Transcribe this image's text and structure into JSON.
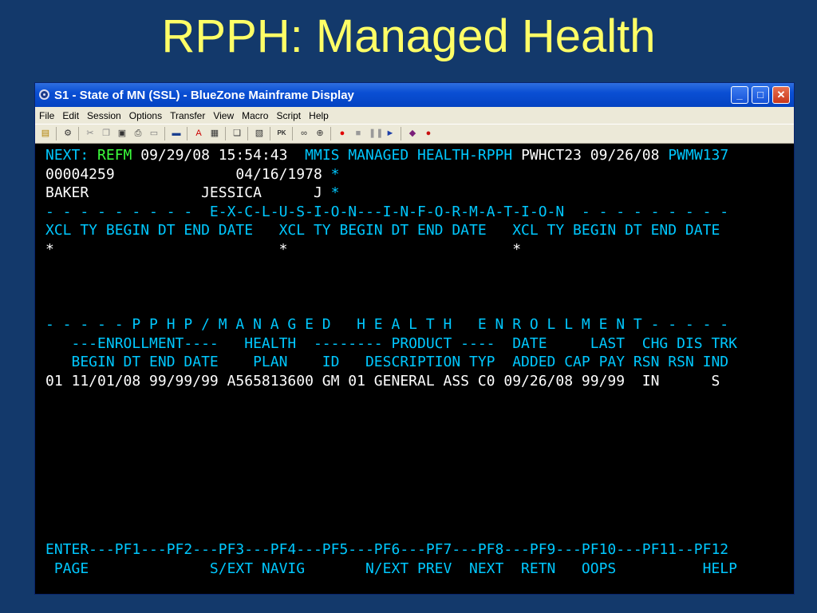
{
  "slide": {
    "title": "RPPH: Managed Health"
  },
  "window": {
    "title": "S1 - State of MN (SSL) - BlueZone Mainframe Display",
    "menu": [
      "File",
      "Edit",
      "Session",
      "Options",
      "Transfer",
      "View",
      "Macro",
      "Script",
      "Help"
    ]
  },
  "toolbar_icons": [
    "new-session-icon",
    "session-properties-icon",
    "cut-icon",
    "copy-icon",
    "save-icon",
    "print-icon",
    "print-preview-icon",
    "display-icon",
    "font-icon",
    "keyboard-map-icon",
    "clipboard-icon",
    "script-icon",
    "pk-icon",
    "glasses-icon",
    "zoom-icon",
    "record-icon",
    "stop-icon",
    "pause-icon",
    "play-icon",
    "book-icon",
    "apple-icon"
  ],
  "colors": {
    "cyan": "#00c8ff",
    "white": "#ffffff",
    "green": "#3cff3c",
    "title_yellow": "#ffff66",
    "background": "#13396b"
  },
  "terminal": {
    "r1": {
      "next_label": "NEXT: ",
      "next_value": "REFM",
      "timestamp": " 09/29/08 15:54:43  ",
      "system": "MMIS MANAGED HEALTH-RPPH ",
      "user": "PWHCT23 09/26/08 ",
      "terminal_id": "PWMW137"
    },
    "r2": {
      "id": "00004259              04/16/1978 ",
      "star": "*"
    },
    "r3": {
      "name": "BAKER             JESSICA      J ",
      "star": "*"
    },
    "r4": "- - - - - - - - -  E-X-C-L-U-S-I-O-N---I-N-F-O-R-M-A-T-I-O-N  - - - - - - - - -",
    "r5": "XCL TY BEGIN DT END DATE   XCL TY BEGIN DT END DATE   XCL TY BEGIN DT END DATE",
    "r6": "*                          *                          *",
    "r7": "- - - - - P P H P / M A N A G E D   H E A L T H   E N R O L L M E N T - - - - -",
    "r8": {
      "a": "   ---ENROLLMENT----   HEALTH  -------- PRODUCT ----  ",
      "b": "DATE     LAST  CHG DIS TRK"
    },
    "r9": {
      "a": "   BEGIN DT END DATE    PLAN    ID   DESCRIPTION TYP  ",
      "b": "ADDED CAP PAY RSN RSN IND"
    },
    "r10": "01 11/01/08 99/99/99 A565813600 GM 01 GENERAL ASS C0 09/26/08 99/99  IN      S",
    "r11": "ENTER---PF1---PF2---PF3---PF4---PF5---PF6---PF7---PF8---PF9---PF10---PF11--PF12",
    "r12": " PAGE              S/EXT NAVIG       N/EXT PREV  NEXT  RETN   OOPS          HELP"
  }
}
